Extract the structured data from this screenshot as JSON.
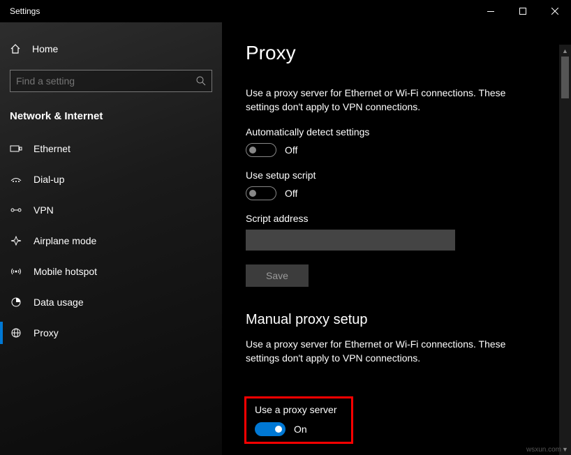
{
  "titlebar": {
    "title": "Settings"
  },
  "sidebar": {
    "home": "Home",
    "search_placeholder": "Find a setting",
    "category": "Network & Internet",
    "items": [
      {
        "label": "Ethernet"
      },
      {
        "label": "Dial-up"
      },
      {
        "label": "VPN"
      },
      {
        "label": "Airplane mode"
      },
      {
        "label": "Mobile hotspot"
      },
      {
        "label": "Data usage"
      },
      {
        "label": "Proxy"
      }
    ]
  },
  "page": {
    "heading": "Proxy",
    "desc1": "Use a proxy server for Ethernet or Wi-Fi connections. These settings don't apply to VPN connections.",
    "auto_detect_label": "Automatically detect settings",
    "auto_detect_state": "Off",
    "setup_script_label": "Use setup script",
    "setup_script_state": "Off",
    "script_address_label": "Script address",
    "script_address_value": "",
    "save_label": "Save",
    "manual_title": "Manual proxy setup",
    "desc2": "Use a proxy server for Ethernet or Wi-Fi connections. These settings don't apply to VPN connections.",
    "use_proxy_label": "Use a proxy server",
    "use_proxy_state": "On"
  },
  "watermark": "wsxun.com"
}
